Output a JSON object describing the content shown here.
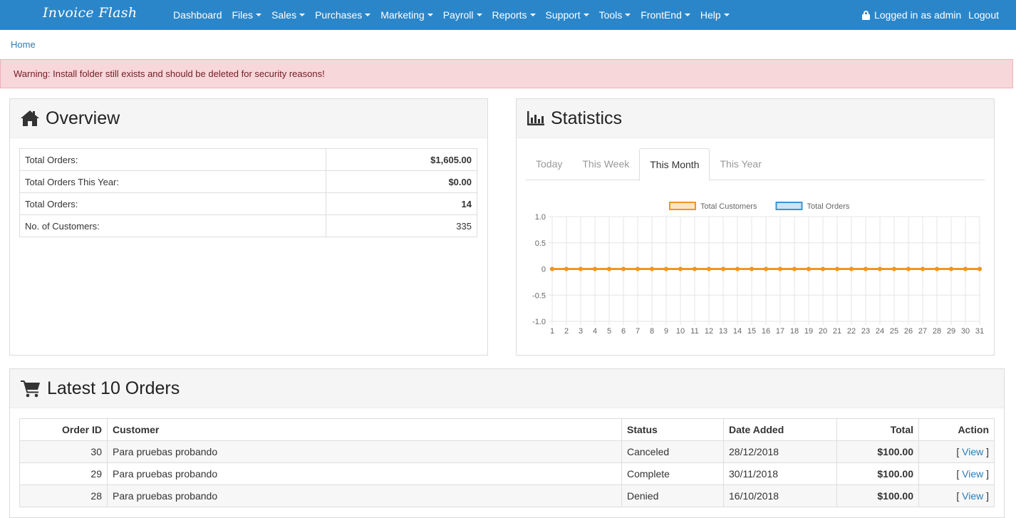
{
  "nav": {
    "brand": "Invoice Flash",
    "items": [
      {
        "label": "Dashboard",
        "dropdown": false
      },
      {
        "label": "Files",
        "dropdown": true
      },
      {
        "label": "Sales",
        "dropdown": true
      },
      {
        "label": "Purchases",
        "dropdown": true
      },
      {
        "label": "Marketing",
        "dropdown": true
      },
      {
        "label": "Payroll",
        "dropdown": true
      },
      {
        "label": "Reports",
        "dropdown": true
      },
      {
        "label": "Support",
        "dropdown": true
      },
      {
        "label": "Tools",
        "dropdown": true
      },
      {
        "label": "FrontEnd",
        "dropdown": true
      },
      {
        "label": "Help",
        "dropdown": true
      }
    ],
    "logged_in_text": "Logged in as admin",
    "logout_label": "Logout"
  },
  "breadcrumb": "Home",
  "alert": "Warning: Install folder still exists and should be deleted for security reasons!",
  "overview": {
    "title": "Overview",
    "rows": [
      {
        "label": "Total Orders:",
        "value": "$1,605.00"
      },
      {
        "label": "Total Orders This Year:",
        "value": "$0.00"
      },
      {
        "label": "Total Orders:",
        "value": "14"
      },
      {
        "label": "No. of Customers:",
        "value": "335"
      }
    ]
  },
  "statistics": {
    "title": "Statistics",
    "tabs": [
      "Today",
      "This Week",
      "This Month",
      "This Year"
    ],
    "active_tab": "This Month"
  },
  "chart_data": {
    "type": "line",
    "x": [
      "1",
      "2",
      "3",
      "4",
      "5",
      "6",
      "7",
      "8",
      "9",
      "10",
      "11",
      "12",
      "13",
      "14",
      "15",
      "16",
      "17",
      "18",
      "19",
      "20",
      "21",
      "22",
      "23",
      "24",
      "25",
      "26",
      "27",
      "28",
      "29",
      "30",
      "31"
    ],
    "series": [
      {
        "name": "Total Customers",
        "color": "#f0961e",
        "values": [
          0,
          0,
          0,
          0,
          0,
          0,
          0,
          0,
          0,
          0,
          0,
          0,
          0,
          0,
          0,
          0,
          0,
          0,
          0,
          0,
          0,
          0,
          0,
          0,
          0,
          0,
          0,
          0,
          0,
          0,
          0
        ]
      },
      {
        "name": "Total Orders",
        "color": "#3a95d6",
        "values": [
          0,
          0,
          0,
          0,
          0,
          0,
          0,
          0,
          0,
          0,
          0,
          0,
          0,
          0,
          0,
          0,
          0,
          0,
          0,
          0,
          0,
          0,
          0,
          0,
          0,
          0,
          0,
          0,
          0,
          0,
          0
        ]
      }
    ],
    "yticks": [
      "1.0",
      "0.5",
      "0",
      "-0.5",
      "-1.0"
    ],
    "ylim": [
      -1,
      1
    ],
    "legend": "top",
    "grid": true
  },
  "orders": {
    "title": "Latest 10 Orders",
    "columns": [
      "Order ID",
      "Customer",
      "Status",
      "Date Added",
      "Total",
      "Action"
    ],
    "rows": [
      {
        "id": "30",
        "customer": "Para pruebas probando",
        "status": "Canceled",
        "date": "28/12/2018",
        "total": "$100.00",
        "action": "View"
      },
      {
        "id": "29",
        "customer": "Para pruebas probando",
        "status": "Complete",
        "date": "30/11/2018",
        "total": "$100.00",
        "action": "View"
      },
      {
        "id": "28",
        "customer": "Para pruebas probando",
        "status": "Denied",
        "date": "16/10/2018",
        "total": "$100.00",
        "action": "View"
      }
    ]
  }
}
